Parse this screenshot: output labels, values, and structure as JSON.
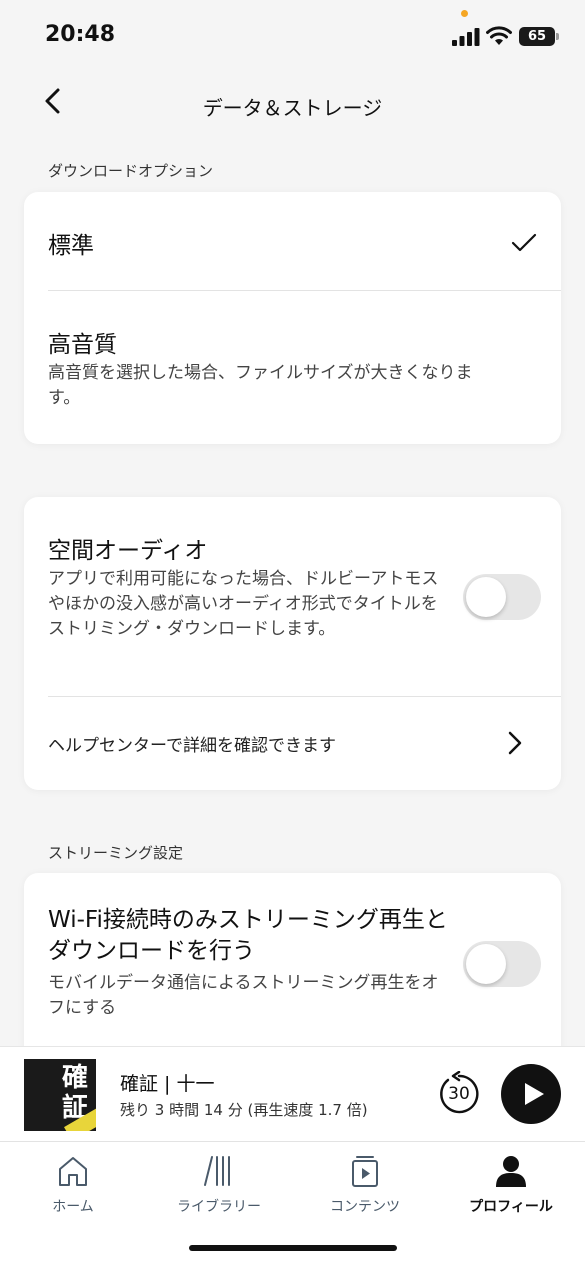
{
  "status_bar": {
    "time": "20:48",
    "battery": "65"
  },
  "header": {
    "title": "データ＆ストレージ"
  },
  "download_options": {
    "section_label": "ダウンロードオプション",
    "standard_label": "標準",
    "high_quality_label": "高音質",
    "high_quality_desc": "高音質を選択した場合、ファイルサイズが大きくなります。"
  },
  "spatial_audio": {
    "title": "空間オーディオ",
    "description": "アプリで利用可能になった場合、ドルビーアトモスやほかの没入感が高いオーディオ形式でタイトルをストリミング・ダウンロードします。",
    "enabled": false,
    "help_link": "ヘルプセンターで詳細を確認できます"
  },
  "streaming": {
    "section_label": "ストリーミング設定",
    "wifi_only_title": "Wi-Fi接続時のみストリーミング再生とダウンロードを行う",
    "wifi_only_desc": "モバイルデータ通信によるストリーミング再生をオフにする",
    "enabled": false
  },
  "mini_player": {
    "title": "確証 | 十一",
    "subtitle": "残り 3 時間 14 分 (再生速度 1.7 倍)",
    "cover_text": "確証",
    "rewind_seconds": "30"
  },
  "tab_bar": {
    "items": [
      {
        "label": "ホーム",
        "icon": "home-icon"
      },
      {
        "label": "ライブラリー",
        "icon": "library-icon"
      },
      {
        "label": "コンテンツ",
        "icon": "content-icon"
      },
      {
        "label": "プロフィール",
        "icon": "profile-icon"
      }
    ],
    "active": "プロフィール"
  }
}
